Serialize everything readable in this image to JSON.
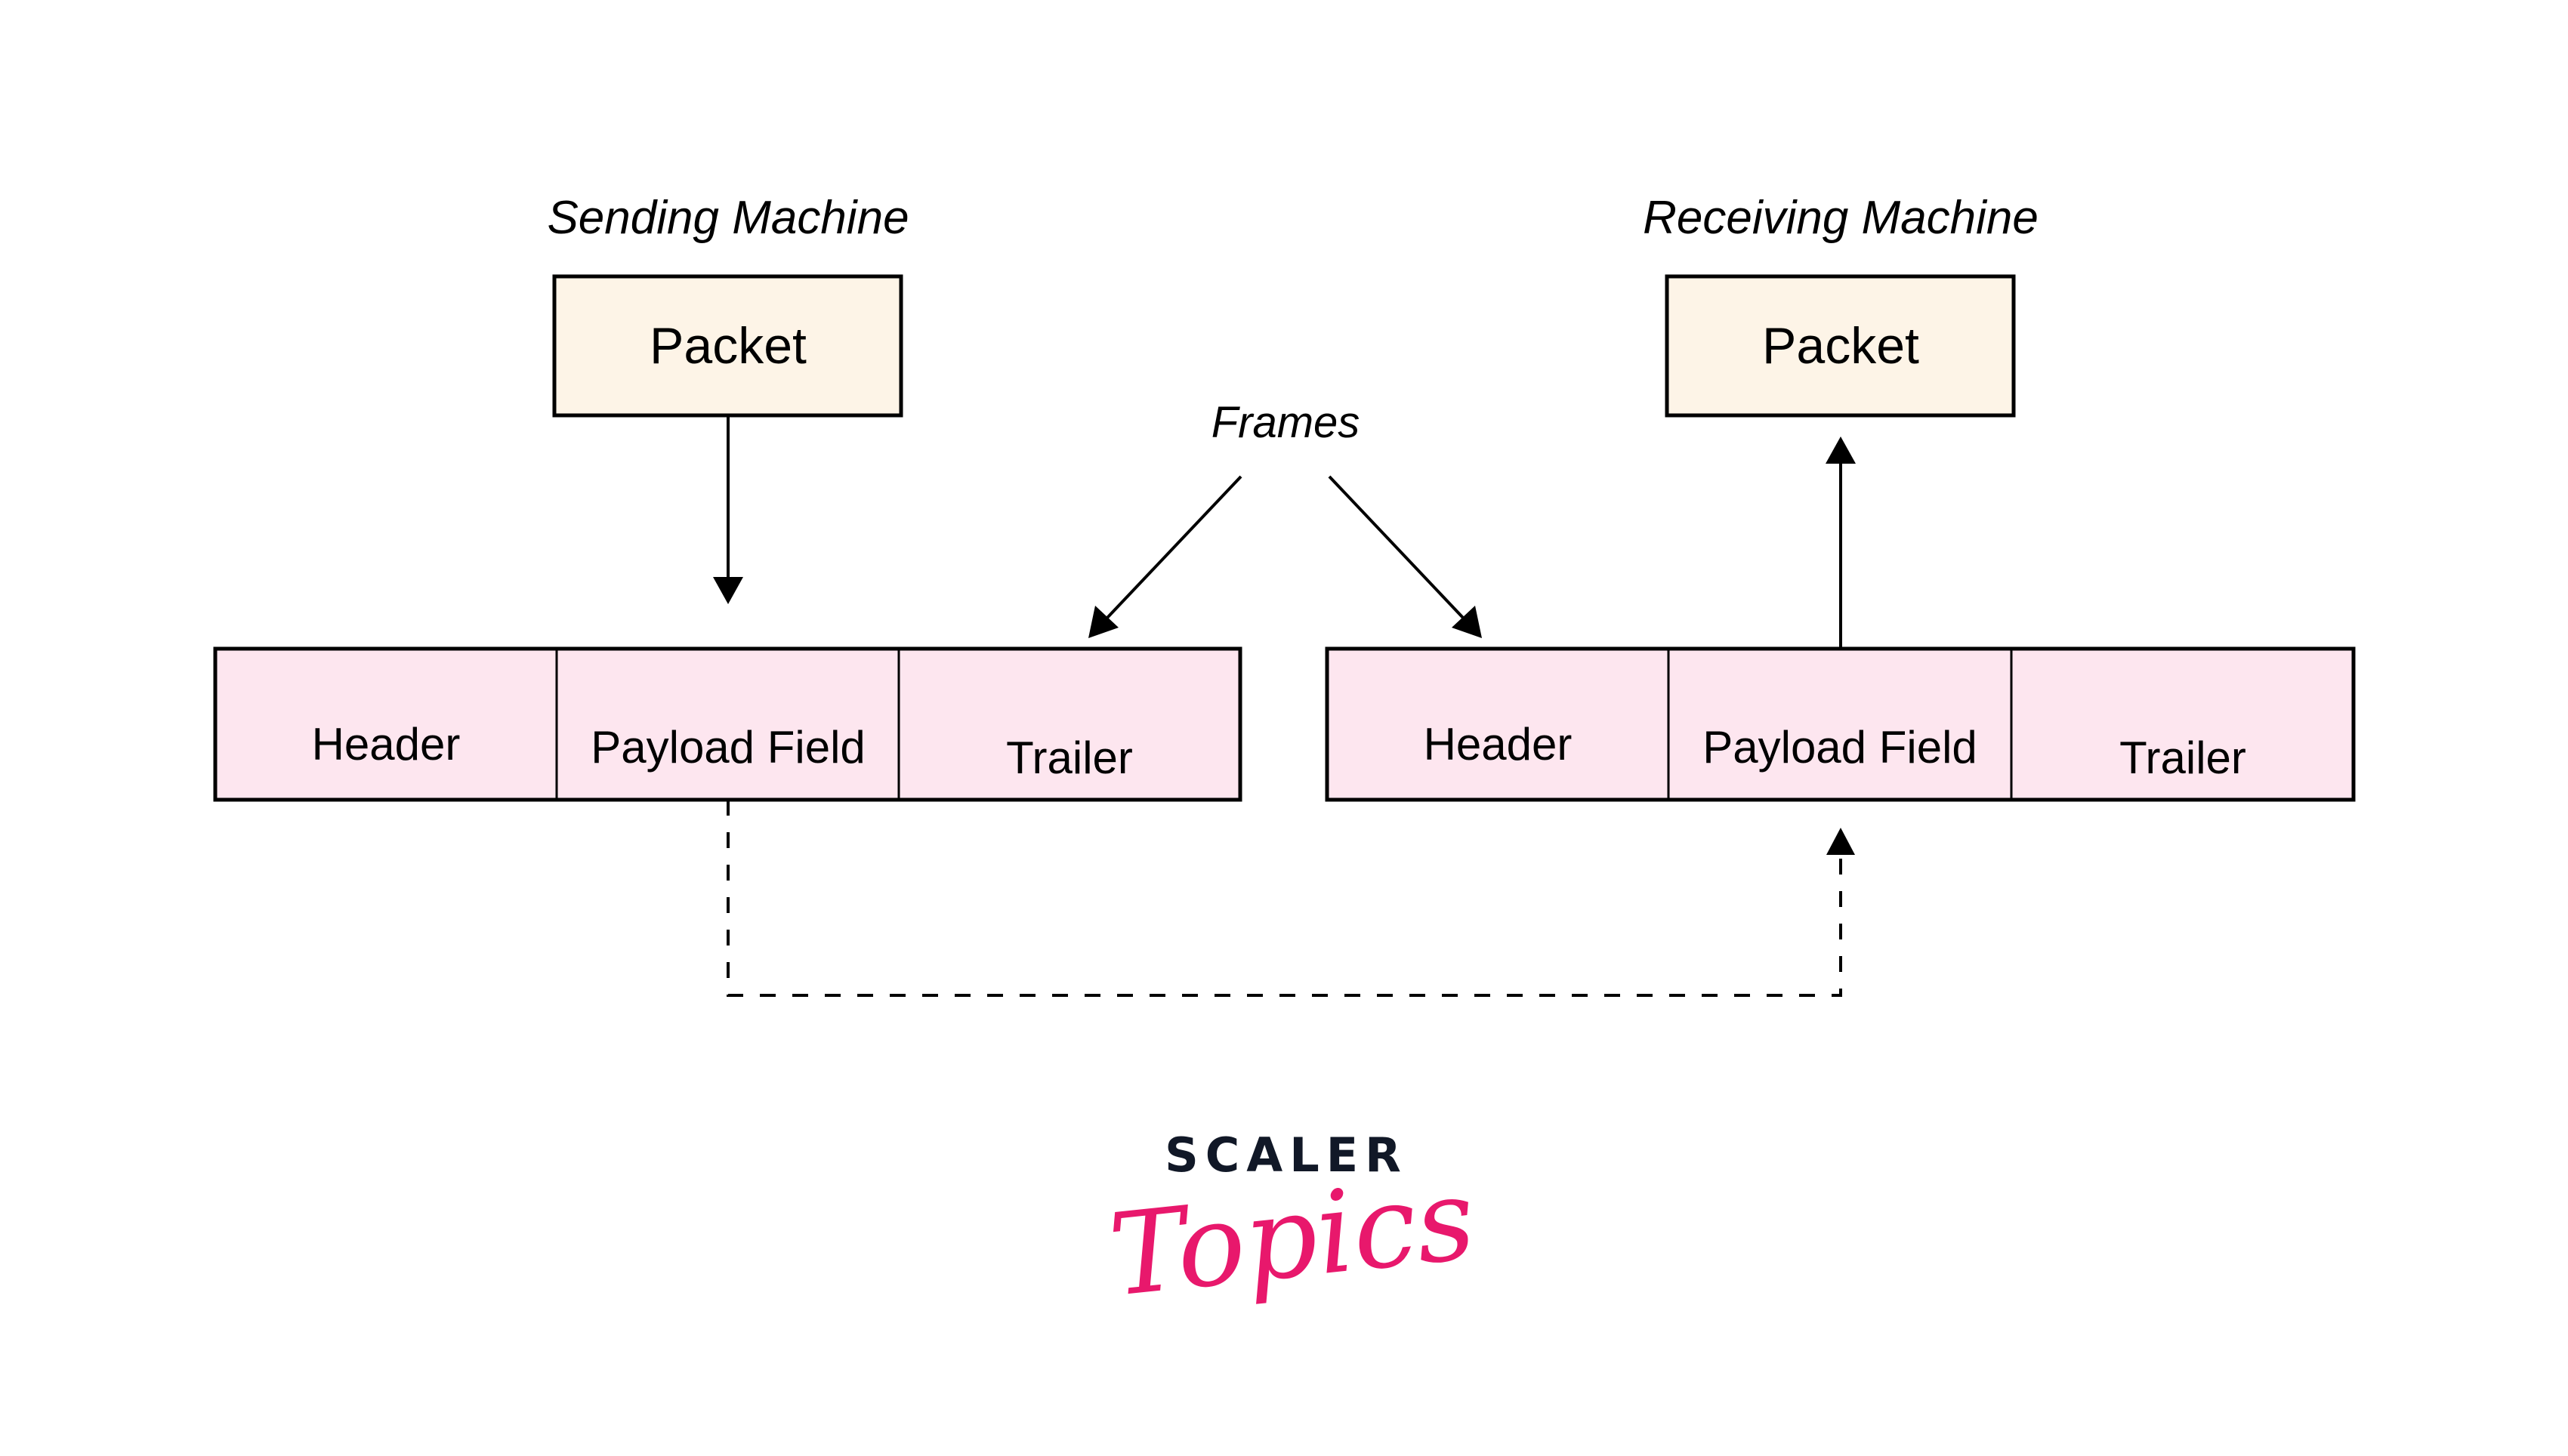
{
  "diagram": {
    "sending_machine": {
      "title": "Sending Machine",
      "packet_label": "Packet"
    },
    "receiving_machine": {
      "title": "Receiving Machine",
      "packet_label": "Packet"
    },
    "frames_label": "Frames",
    "sending_frame": {
      "fields": [
        "Header",
        "Payload Field",
        "Trailer"
      ]
    },
    "receiving_frame": {
      "fields": [
        "Header",
        "Payload Field",
        "Trailer"
      ]
    },
    "edges": [
      {
        "from": "sending-packet",
        "to": "sending-frame-payload",
        "style": "solid"
      },
      {
        "from": "frames-label",
        "to": "sending-frame",
        "style": "solid"
      },
      {
        "from": "frames-label",
        "to": "receiving-frame",
        "style": "solid"
      },
      {
        "from": "receiving-frame-payload",
        "to": "receiving-packet",
        "style": "solid"
      },
      {
        "from": "sending-frame-payload",
        "to": "receiving-frame-payload",
        "style": "dashed"
      }
    ]
  },
  "colors": {
    "packet_fill": "#fdf4e7",
    "frame_fill": "#fde6ef",
    "stroke": "#000000",
    "logo_dark": "#111827",
    "logo_pink": "#e8186c"
  },
  "logo": {
    "brand": "SCALER",
    "sub": "Topics"
  }
}
